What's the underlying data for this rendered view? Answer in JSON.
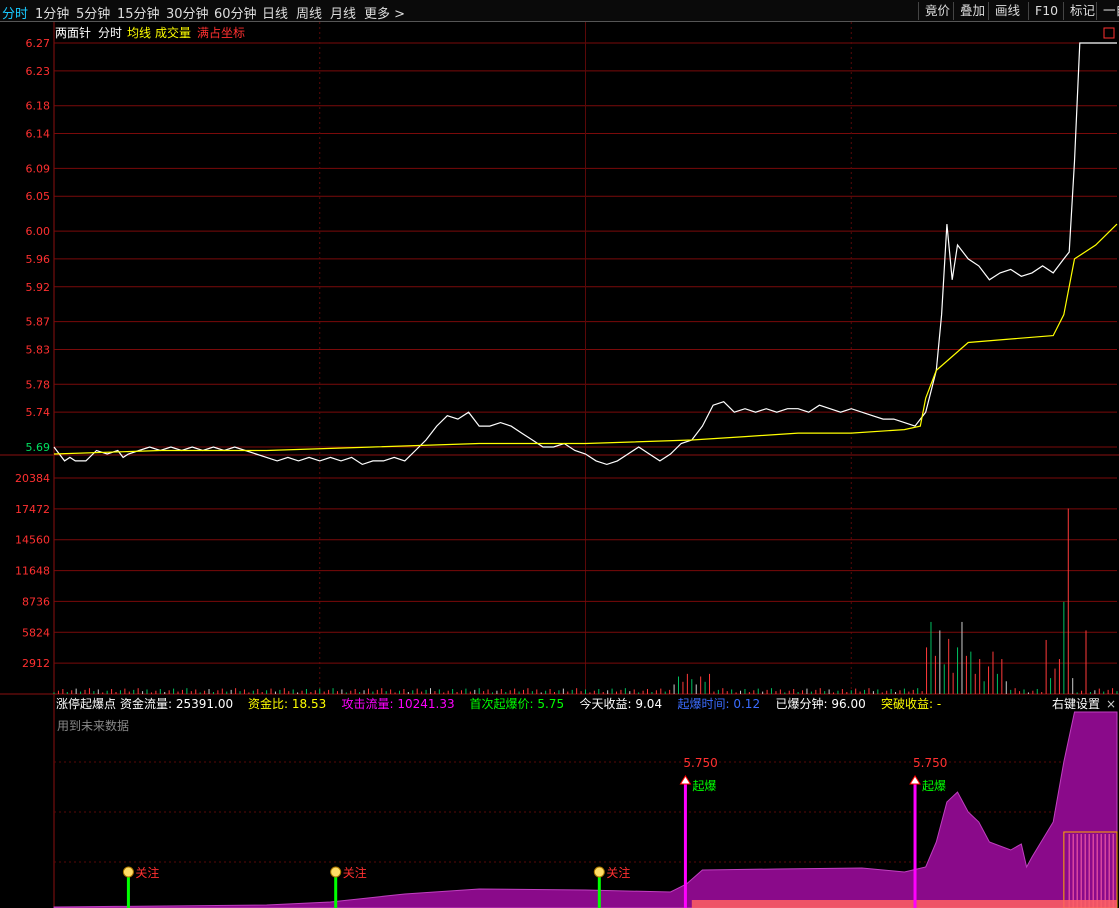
{
  "toolbar": {
    "tabs": [
      "分时",
      "1分钟",
      "5分钟",
      "15分钟",
      "30分钟",
      "60分钟",
      "日线",
      "周线",
      "月线",
      "更多 >"
    ],
    "active_tab": "分时",
    "right_buttons": [
      "竟价",
      "叠加",
      "画线",
      "F10",
      "标记",
      "一自"
    ]
  },
  "price_panel": {
    "legend": [
      "两面针",
      "分时",
      "均线",
      "成交量",
      "满占坐标"
    ],
    "legend_colors": [
      "#ffffff",
      "#ffffff",
      "#ffff00",
      "#ffff00",
      "#ff3030"
    ],
    "corner_icon": "口"
  },
  "volume_panel": {
    "ticks": [
      "20384",
      "17472",
      "14560",
      "11648",
      "8736",
      "5824",
      "2912"
    ]
  },
  "indicator_panel": {
    "title": "涨停起爆点",
    "stats": [
      {
        "label": "资金流量:",
        "value": "25391.00",
        "color": "#ffffff"
      },
      {
        "label": "资金比:",
        "value": "18.53",
        "color": "#ffff00"
      },
      {
        "label": "攻击流量:",
        "value": "10241.33",
        "color": "#ff00ff"
      },
      {
        "label": "首次起爆价:",
        "value": "5.75",
        "color": "#00ff00"
      },
      {
        "label": "今天收益:",
        "value": "9.04",
        "color": "#ffffff"
      },
      {
        "label": "起爆时间:",
        "value": "0.12",
        "color": "#3b6cff"
      },
      {
        "label": "已爆分钟:",
        "value": "96.00",
        "color": "#ffffff"
      },
      {
        "label": "突破收益:",
        "value": "-",
        "color": "#ffff00"
      }
    ],
    "settings_label": "右键设置",
    "close_label": "×",
    "note": "用到未来数据",
    "signals": [
      {
        "type": "关注",
        "x": 0.07
      },
      {
        "type": "关注",
        "x": 0.265
      },
      {
        "type": "关注",
        "x": 0.513
      },
      {
        "type": "起爆",
        "x": 0.594,
        "price": "5.750"
      },
      {
        "type": "起爆",
        "x": 0.81,
        "price": "5.750"
      }
    ]
  },
  "chart_data": {
    "type": "line",
    "price_axis": {
      "ticks": [
        "6.27",
        "6.23",
        "6.18",
        "6.14",
        "6.09",
        "6.05",
        "6.00",
        "5.96",
        "5.92",
        "5.87",
        "5.83",
        "5.78",
        "5.74",
        "5.69"
      ],
      "ylim": [
        5.69,
        6.27
      ],
      "tick_colors": {
        "above": "#ff3030",
        "base": "#00e060"
      }
    },
    "volume_axis": {
      "ylim": [
        0,
        20384
      ]
    },
    "series": [
      {
        "name": "分时",
        "color": "#ffffff",
        "points": [
          [
            0,
            5.69
          ],
          [
            0.005,
            5.68
          ],
          [
            0.01,
            5.67
          ],
          [
            0.015,
            5.675
          ],
          [
            0.02,
            5.67
          ],
          [
            0.03,
            5.67
          ],
          [
            0.04,
            5.685
          ],
          [
            0.05,
            5.68
          ],
          [
            0.06,
            5.685
          ],
          [
            0.065,
            5.675
          ],
          [
            0.07,
            5.68
          ],
          [
            0.08,
            5.685
          ],
          [
            0.09,
            5.69
          ],
          [
            0.1,
            5.685
          ],
          [
            0.11,
            5.69
          ],
          [
            0.12,
            5.685
          ],
          [
            0.13,
            5.69
          ],
          [
            0.14,
            5.685
          ],
          [
            0.15,
            5.69
          ],
          [
            0.16,
            5.685
          ],
          [
            0.17,
            5.69
          ],
          [
            0.18,
            5.685
          ],
          [
            0.19,
            5.68
          ],
          [
            0.2,
            5.675
          ],
          [
            0.21,
            5.67
          ],
          [
            0.22,
            5.675
          ],
          [
            0.23,
            5.67
          ],
          [
            0.24,
            5.675
          ],
          [
            0.25,
            5.67
          ],
          [
            0.26,
            5.675
          ],
          [
            0.27,
            5.67
          ],
          [
            0.28,
            5.675
          ],
          [
            0.29,
            5.665
          ],
          [
            0.3,
            5.67
          ],
          [
            0.31,
            5.67
          ],
          [
            0.32,
            5.675
          ],
          [
            0.33,
            5.67
          ],
          [
            0.34,
            5.685
          ],
          [
            0.35,
            5.7
          ],
          [
            0.36,
            5.72
          ],
          [
            0.37,
            5.735
          ],
          [
            0.38,
            5.73
          ],
          [
            0.39,
            5.74
          ],
          [
            0.4,
            5.72
          ],
          [
            0.41,
            5.72
          ],
          [
            0.42,
            5.725
          ],
          [
            0.43,
            5.72
          ],
          [
            0.44,
            5.71
          ],
          [
            0.45,
            5.7
          ],
          [
            0.46,
            5.69
          ],
          [
            0.47,
            5.69
          ],
          [
            0.48,
            5.695
          ],
          [
            0.49,
            5.685
          ],
          [
            0.5,
            5.68
          ],
          [
            0.51,
            5.67
          ],
          [
            0.52,
            5.665
          ],
          [
            0.53,
            5.67
          ],
          [
            0.54,
            5.68
          ],
          [
            0.55,
            5.69
          ],
          [
            0.56,
            5.68
          ],
          [
            0.57,
            5.67
          ],
          [
            0.58,
            5.68
          ],
          [
            0.59,
            5.695
          ],
          [
            0.6,
            5.7
          ],
          [
            0.61,
            5.72
          ],
          [
            0.62,
            5.75
          ],
          [
            0.63,
            5.755
          ],
          [
            0.64,
            5.74
          ],
          [
            0.65,
            5.745
          ],
          [
            0.66,
            5.74
          ],
          [
            0.67,
            5.745
          ],
          [
            0.68,
            5.74
          ],
          [
            0.69,
            5.745
          ],
          [
            0.7,
            5.745
          ],
          [
            0.71,
            5.74
          ],
          [
            0.72,
            5.75
          ],
          [
            0.73,
            5.745
          ],
          [
            0.74,
            5.74
          ],
          [
            0.75,
            5.745
          ],
          [
            0.76,
            5.74
          ],
          [
            0.77,
            5.735
          ],
          [
            0.78,
            5.73
          ],
          [
            0.79,
            5.73
          ],
          [
            0.8,
            5.725
          ],
          [
            0.81,
            5.72
          ],
          [
            0.82,
            5.74
          ],
          [
            0.83,
            5.8
          ],
          [
            0.835,
            5.88
          ],
          [
            0.84,
            6.01
          ],
          [
            0.845,
            5.93
          ],
          [
            0.85,
            5.98
          ],
          [
            0.86,
            5.96
          ],
          [
            0.87,
            5.95
          ],
          [
            0.88,
            5.93
          ],
          [
            0.89,
            5.94
          ],
          [
            0.9,
            5.945
          ],
          [
            0.91,
            5.935
          ],
          [
            0.92,
            5.94
          ],
          [
            0.93,
            5.95
          ],
          [
            0.94,
            5.94
          ],
          [
            0.945,
            5.95
          ],
          [
            0.95,
            5.96
          ],
          [
            0.955,
            5.97
          ],
          [
            0.96,
            6.1
          ],
          [
            0.965,
            6.27
          ],
          [
            0.98,
            6.27
          ],
          [
            1.0,
            6.27
          ]
        ]
      },
      {
        "name": "均线",
        "color": "#ffff00",
        "points": [
          [
            0,
            5.68
          ],
          [
            0.1,
            5.685
          ],
          [
            0.2,
            5.685
          ],
          [
            0.3,
            5.69
          ],
          [
            0.4,
            5.695
          ],
          [
            0.5,
            5.695
          ],
          [
            0.6,
            5.7
          ],
          [
            0.65,
            5.705
          ],
          [
            0.7,
            5.71
          ],
          [
            0.75,
            5.71
          ],
          [
            0.8,
            5.715
          ],
          [
            0.815,
            5.72
          ],
          [
            0.82,
            5.76
          ],
          [
            0.83,
            5.8
          ],
          [
            0.86,
            5.84
          ],
          [
            0.9,
            5.845
          ],
          [
            0.94,
            5.85
          ],
          [
            0.95,
            5.88
          ],
          [
            0.96,
            5.96
          ],
          [
            0.98,
            5.98
          ],
          [
            1.0,
            6.01
          ]
        ]
      }
    ]
  }
}
